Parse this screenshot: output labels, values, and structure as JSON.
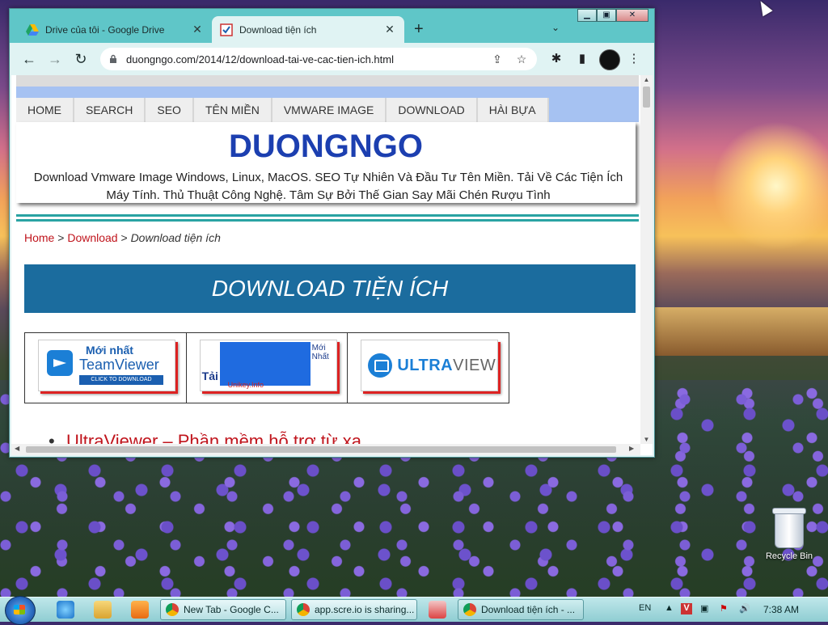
{
  "desktop": {
    "recycle_bin_label": "Recycle Bin"
  },
  "browser": {
    "tabs": [
      {
        "title": "Drive của tôi - Google Drive",
        "icon": "google-drive-icon",
        "active": false
      },
      {
        "title": "Download tiện ích",
        "icon": "site-favicon-icon",
        "active": true
      }
    ],
    "new_tab_symbol": "+",
    "tab_list_symbol": "⌄",
    "window_controls": {
      "minimize": "▁",
      "maximize": "▣",
      "close": "✕"
    },
    "nav": {
      "back": "←",
      "forward": "→",
      "reload": "↻"
    },
    "url": "duongngo.com/2014/12/download-tai-ve-cac-tien-ich.html",
    "omnibox_icons": {
      "share": "⇪",
      "bookmark": "☆"
    },
    "toolbar_icons": {
      "extensions": "✱",
      "side_panel": "▮",
      "menu": "⋮"
    }
  },
  "page": {
    "menu": [
      "HOME",
      "SEARCH",
      "SEO",
      "TÊN MIỀN",
      "VMWARE IMAGE",
      "DOWNLOAD",
      "HÀI BỰA"
    ],
    "site_title": "DUONGNGO",
    "tagline": "Download Vmware Image Windows, Linux, MacOS. SEO Tự Nhiên Và Đầu Tư Tên Miền. Tải Về Các Tiện Ích Máy Tính. Thủ Thuật Công Nghệ. Tâm Sự Bởi Thế Gian Say Mãi Chén Rượu Tình",
    "breadcrumb": {
      "home": "Home",
      "sep": ">",
      "section": "Download",
      "current": "Download tiện ích"
    },
    "banner": "DOWNLOAD TIỆN ÍCH",
    "promos": {
      "teamviewer": {
        "line1": "Mới nhất",
        "line2": "TeamViewer",
        "line3": "CLICK TO DOWNLOAD"
      },
      "unikey": {
        "line1": "Mới Nhất",
        "line2": "Tải",
        "line3": "Unikey.Info"
      },
      "ultraviewer": {
        "bold": "ULTRA",
        "rest": "VIEWER"
      }
    },
    "list_peek": "UltraViewer – Phần mềm hỗ trợ từ xa"
  },
  "taskbar": {
    "buttons": [
      {
        "label": "New Tab - Google C..."
      },
      {
        "label": "app.scre.io is sharing..."
      },
      {
        "label": "Download tiện ích - ..."
      }
    ],
    "language": "EN",
    "clock": "7:38 AM"
  }
}
